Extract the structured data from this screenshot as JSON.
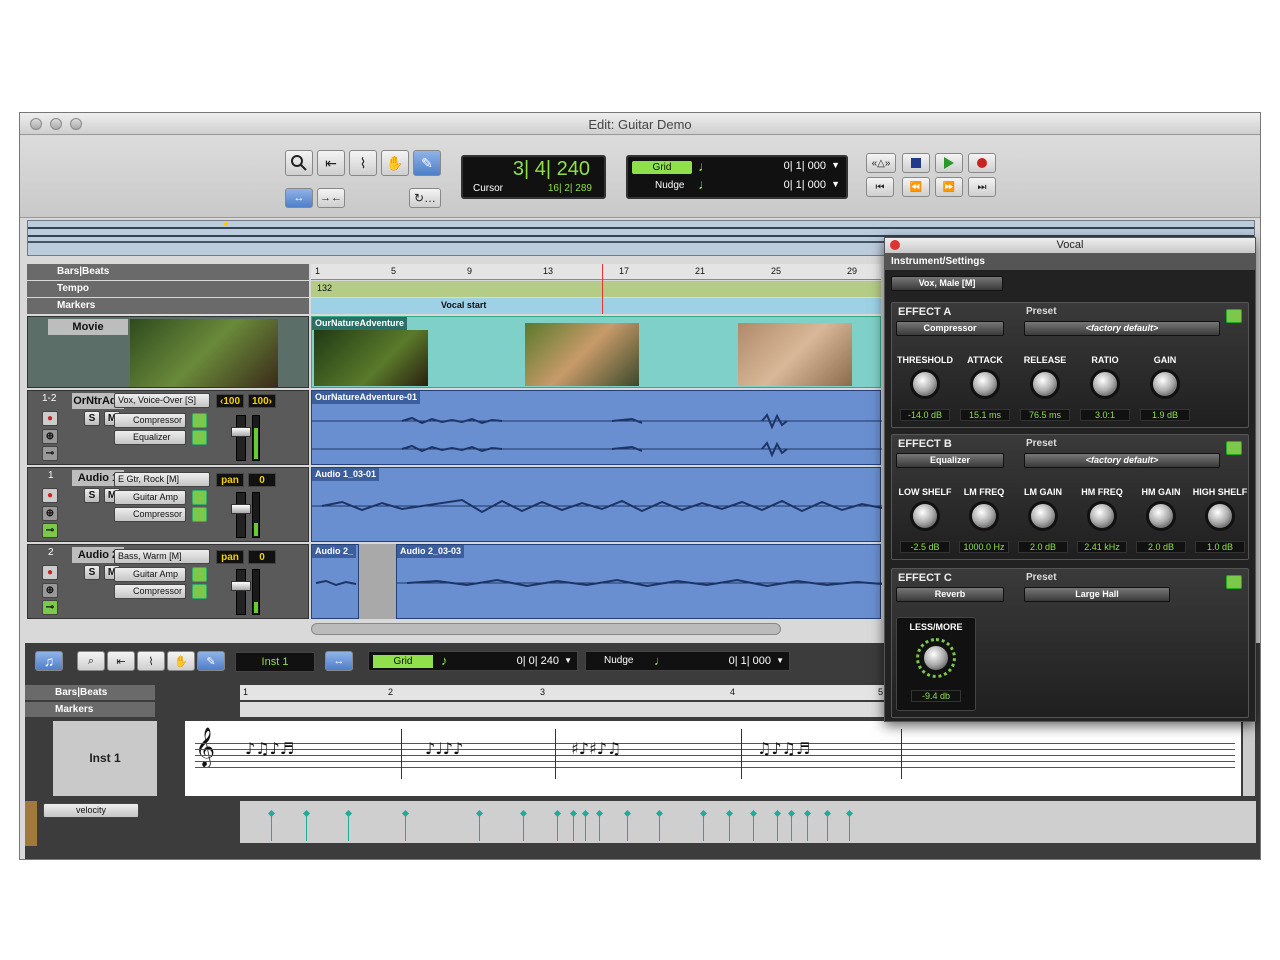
{
  "window": {
    "title": "Edit: Guitar Demo"
  },
  "counters": {
    "main_value": "3| 4| 240",
    "cursor_label": "Cursor",
    "cursor_value": "16| 2| 289",
    "grid_label": "Grid",
    "grid_value": "0| 1| 000",
    "nudge_label": "Nudge",
    "nudge_value": "0| 1| 000"
  },
  "rulers": {
    "bars_beats": "Bars|Beats",
    "tempo": "Tempo",
    "tempo_value": "132",
    "markers": "Markers",
    "marker_vocal": "Vocal start",
    "ticks": [
      "1",
      "5",
      "9",
      "13",
      "17",
      "21",
      "25",
      "29"
    ]
  },
  "tracks": {
    "movie": {
      "name": "Movie",
      "clip": "OurNatureAdventure"
    },
    "vo": {
      "num": "1-2",
      "name": "OrNtrAdv",
      "preset": "Vox, Voice-Over [S]",
      "pan_l": "‹100",
      "pan_r": "100›",
      "inserts": [
        "Compressor",
        "Equalizer"
      ],
      "clip": "OurNatureAdventure-01"
    },
    "a1": {
      "num": "1",
      "name": "Audio 1",
      "preset": "E Gtr, Rock [M]",
      "pan": "pan",
      "pan_val": "0",
      "inserts": [
        "Guitar Amp",
        "Compressor"
      ],
      "clip": "Audio 1_03-01"
    },
    "a2": {
      "num": "2",
      "name": "Audio 2",
      "preset": "Bass, Warm [M]",
      "pan": "pan",
      "pan_val": "0",
      "inserts": [
        "Guitar Amp",
        "Compressor"
      ],
      "clip_a": "Audio 2_",
      "clip_b": "Audio 2_03-03"
    }
  },
  "plugin": {
    "title": "Vocal",
    "section": "Instrument/Settings",
    "preset": "Vox, Male [M]",
    "preset_label": "Preset",
    "effect_a": {
      "title": "EFFECT A",
      "type": "Compressor",
      "preset": "<factory default>",
      "knobs": [
        {
          "label": "THRESHOLD",
          "value": "-14.0 dB"
        },
        {
          "label": "ATTACK",
          "value": "15.1 ms"
        },
        {
          "label": "RELEASE",
          "value": "76.5 ms"
        },
        {
          "label": "RATIO",
          "value": "3.0:1"
        },
        {
          "label": "GAIN",
          "value": "1.9 dB"
        }
      ]
    },
    "effect_b": {
      "title": "EFFECT B",
      "type": "Equalizer",
      "preset": "<factory default>",
      "knobs": [
        {
          "label": "LOW SHELF",
          "value": "-2.5 dB"
        },
        {
          "label": "LM FREQ",
          "value": "1000.0 Hz"
        },
        {
          "label": "LM GAIN",
          "value": "2.0 dB"
        },
        {
          "label": "HM FREQ",
          "value": "2.41 kHz"
        },
        {
          "label": "HM GAIN",
          "value": "2.0 dB"
        },
        {
          "label": "HIGH SHELF",
          "value": "1.0 dB"
        }
      ]
    },
    "effect_c": {
      "title": "EFFECT C",
      "type": "Reverb",
      "preset": "Large Hall"
    },
    "lessmore": {
      "label": "LESS/MORE",
      "value": "-9.4 db"
    }
  },
  "midi": {
    "instrument": "Inst 1",
    "grid_label": "Grid",
    "grid_value": "0| 0| 240",
    "nudge_label": "Nudge",
    "nudge_value": "0| 1| 000",
    "bars_beats": "Bars|Beats",
    "markers": "Markers",
    "ticks": [
      "1",
      "2",
      "3",
      "4",
      "5"
    ],
    "track_name": "Inst 1",
    "velocity": "velocity",
    "velocity_x": [
      270,
      305,
      347,
      404,
      478,
      522,
      556,
      572,
      584,
      598,
      626,
      658,
      702,
      728,
      752,
      776,
      790,
      806,
      826,
      848
    ]
  },
  "colors": {
    "accent_green": "#8fe04a",
    "clip_blue": "#6a8fd0",
    "movie_teal": "#7fd0c8"
  }
}
